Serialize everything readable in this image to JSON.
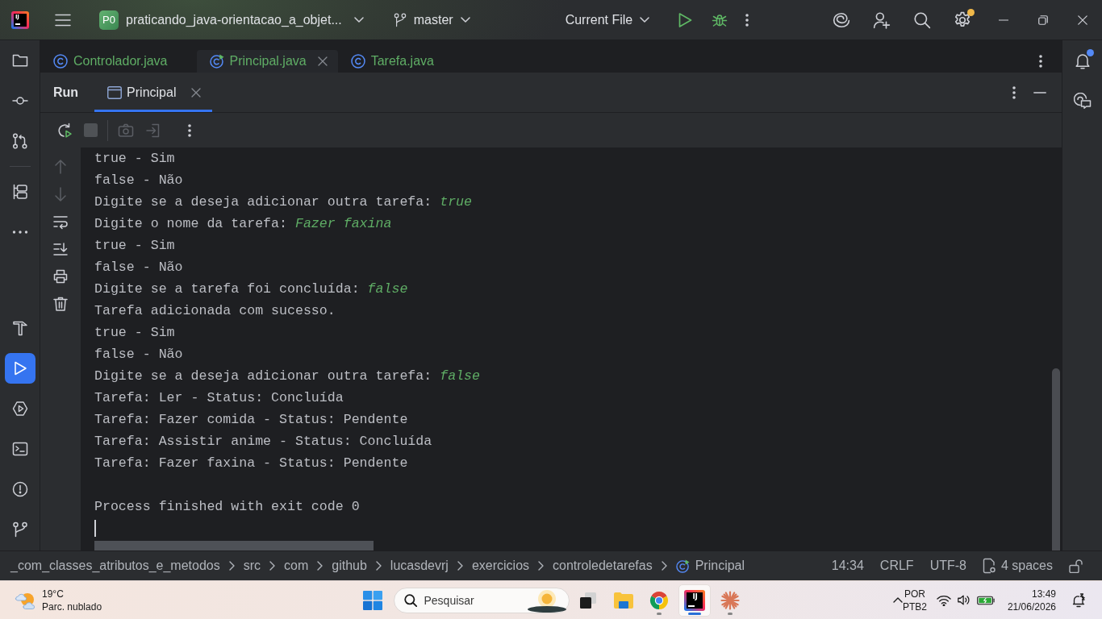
{
  "title_bar": {
    "logo": "IJ",
    "project_badge": "P0",
    "project_name": "praticando_java-orientacao_a_objet...",
    "branch": "master",
    "run_configuration": "Current File",
    "settings_badge": true
  },
  "left_toolbar": {
    "top": [
      {
        "selected": false
      },
      {
        "selected": false
      },
      {
        "selected": false
      },
      {
        "selected": false
      },
      {
        "selected": false
      }
    ],
    "bottom": [
      {
        "selected": false
      },
      {
        "selected": true
      },
      {
        "selected": false
      },
      {
        "selected": false
      },
      {
        "selected": false
      },
      {
        "selected": false
      }
    ]
  },
  "right_toolbar": {
    "notifications_unread": true
  },
  "editor_tabs": [
    {
      "label": "Controlador.java",
      "kind": "class",
      "selected": false
    },
    {
      "label": "Principal.java",
      "kind": "main",
      "selected": true
    },
    {
      "label": "Tarefa.java",
      "kind": "class",
      "selected": false
    }
  ],
  "run_panel": {
    "title": "Run",
    "tabs": [
      {
        "label": "Principal",
        "selected": true
      }
    ],
    "toolbar": [
      {
        "disabled": false
      },
      {
        "disabled": true
      },
      {
        "disabled": true
      },
      {
        "disabled": true
      }
    ],
    "gutter": [
      {
        "disabled": true
      },
      {
        "disabled": true
      },
      {
        "disabled": false
      },
      {
        "disabled": false
      },
      {
        "disabled": false
      },
      {
        "disabled": false
      }
    ]
  },
  "console": {
    "lines": [
      {
        "text": "true - Sim"
      },
      {
        "text": "false - Não"
      },
      {
        "text": "Digite se a deseja adicionar outra tarefa: ",
        "input": "true"
      },
      {
        "text": "Digite o nome da tarefa: ",
        "input": "Fazer faxina"
      },
      {
        "text": "true - Sim"
      },
      {
        "text": "false - Não"
      },
      {
        "text": "Digite se a tarefa foi concluída: ",
        "input": "false"
      },
      {
        "text": "Tarefa adicionada com sucesso."
      },
      {
        "text": "true - Sim"
      },
      {
        "text": "false - Não"
      },
      {
        "text": "Digite se a deseja adicionar outra tarefa: ",
        "input": "false"
      },
      {
        "text": "Tarefa: Ler - Status: Concluída"
      },
      {
        "text": "Tarefa: Fazer comida - Status: Pendente"
      },
      {
        "text": "Tarefa: Assistir anime - Status: Concluída"
      },
      {
        "text": "Tarefa: Fazer faxina - Status: Pendente"
      }
    ],
    "exit_message": "Process finished with exit code 0"
  },
  "breadcrumbs": [
    {
      "label": "_com_classes_atributos_e_metodos",
      "kind": "folder"
    },
    {
      "label": "src",
      "kind": "folder"
    },
    {
      "label": "com",
      "kind": "folder"
    },
    {
      "label": "github",
      "kind": "folder"
    },
    {
      "label": "lucasdevrj",
      "kind": "folder"
    },
    {
      "label": "exercicios",
      "kind": "folder"
    },
    {
      "label": "controledetarefas",
      "kind": "folder"
    },
    {
      "label": "Principal",
      "kind": "main"
    }
  ],
  "status_bar": {
    "position": "14:34",
    "line_separator": "CRLF",
    "encoding": "UTF-8",
    "indent": "4 spaces",
    "read_only": false
  },
  "taskbar": {
    "weather": {
      "temperature": "19°C",
      "condition": "Parc. nublado"
    },
    "search": {
      "placeholder": "Pesquisar"
    },
    "apps": [
      {
        "kind": "task_view",
        "running": false,
        "selected": false
      },
      {
        "kind": "file_explorer",
        "running": false,
        "selected": false
      },
      {
        "kind": "browser",
        "running": true,
        "selected": false
      },
      {
        "kind": "ide",
        "logo_text": "IJ",
        "running": true,
        "selected": true
      },
      {
        "kind": "assistant",
        "running": true,
        "selected": false
      }
    ],
    "tray": {
      "language": "POR",
      "layout": "PTB2",
      "time": "13:49",
      "date": "21/06/2026"
    }
  }
}
